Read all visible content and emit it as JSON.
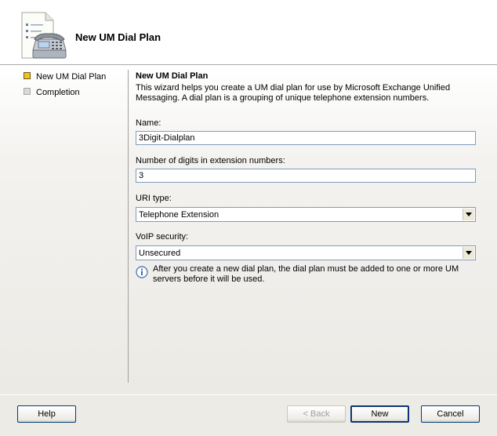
{
  "header": {
    "title": "New UM Dial Plan",
    "icon": "phone-document-icon"
  },
  "nav": {
    "items": [
      {
        "label": "New UM Dial Plan",
        "state": "active"
      },
      {
        "label": "Completion",
        "state": "inactive"
      }
    ]
  },
  "main": {
    "title": "New UM Dial Plan",
    "description": "This wizard helps you create a UM dial plan for use by Microsoft Exchange Unified Messaging. A dial plan is a grouping of unique telephone extension numbers.",
    "name": {
      "label": "Name:",
      "value": "3Digit-Dialplan"
    },
    "digits": {
      "label": "Number of digits in extension numbers:",
      "value": "3"
    },
    "uri_type": {
      "label": "URI type:",
      "value": "Telephone Extension"
    },
    "voip_security": {
      "label": "VoIP security:",
      "value": "Unsecured"
    },
    "info_text": "After you create a new dial plan, the dial plan must be added to one or more UM servers before it will be used."
  },
  "buttons": {
    "help": "Help",
    "back": "< Back",
    "new": "New",
    "cancel": "Cancel"
  },
  "colors": {
    "active_bullet": "#f2c21e",
    "input_border": "#7f9db9",
    "button_border": "#003c74"
  }
}
